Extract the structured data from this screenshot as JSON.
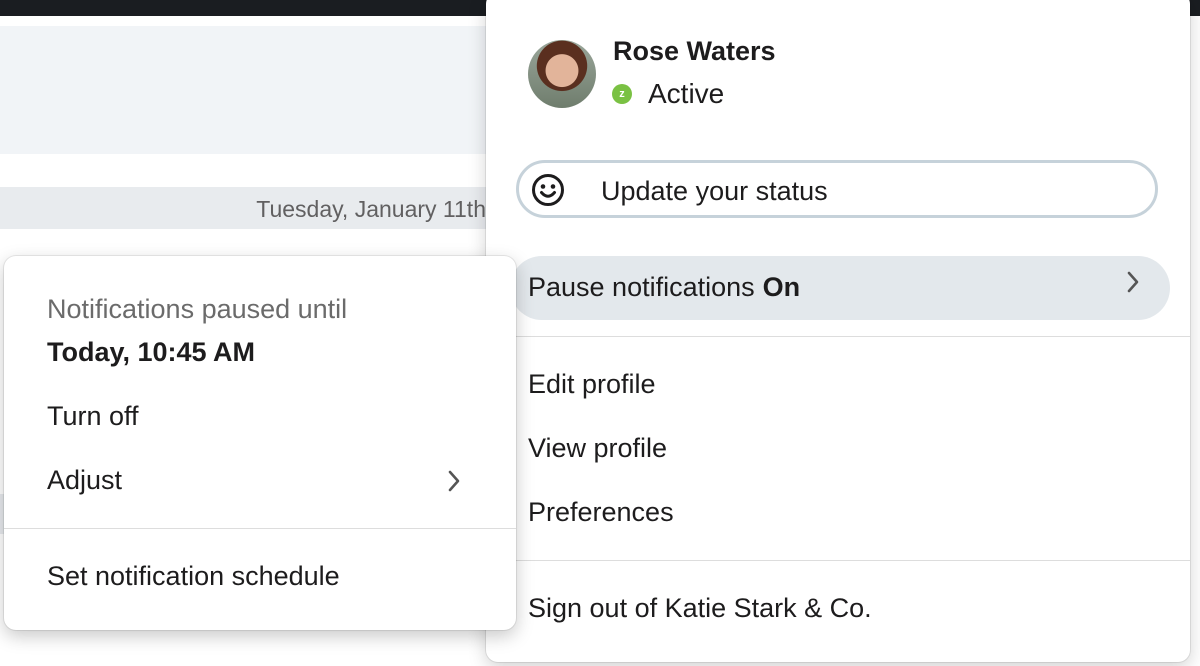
{
  "background": {
    "date_label": "Tuesday, January 11th"
  },
  "profile": {
    "name": "Rose Waters",
    "presence": "Active",
    "status_placeholder": "Update your status",
    "pause": {
      "label": "Pause notifications",
      "state": "On"
    },
    "items": {
      "edit_profile": "Edit profile",
      "view_profile": "View profile",
      "preferences": "Preferences",
      "sign_out": "Sign out of Katie Stark & Co."
    },
    "colors": {
      "presence": "#7ac143",
      "hover_row": "#e3e8ec"
    }
  },
  "notifications": {
    "paused_until_label": "Notifications paused until",
    "paused_until_time": "Today, 10:45 AM",
    "turn_off": "Turn off",
    "adjust": "Adjust",
    "schedule": "Set notification schedule"
  },
  "icons": {
    "presence": "away-z-icon",
    "status": "smiley-face-icon",
    "chevron": "chevron-right-icon"
  }
}
